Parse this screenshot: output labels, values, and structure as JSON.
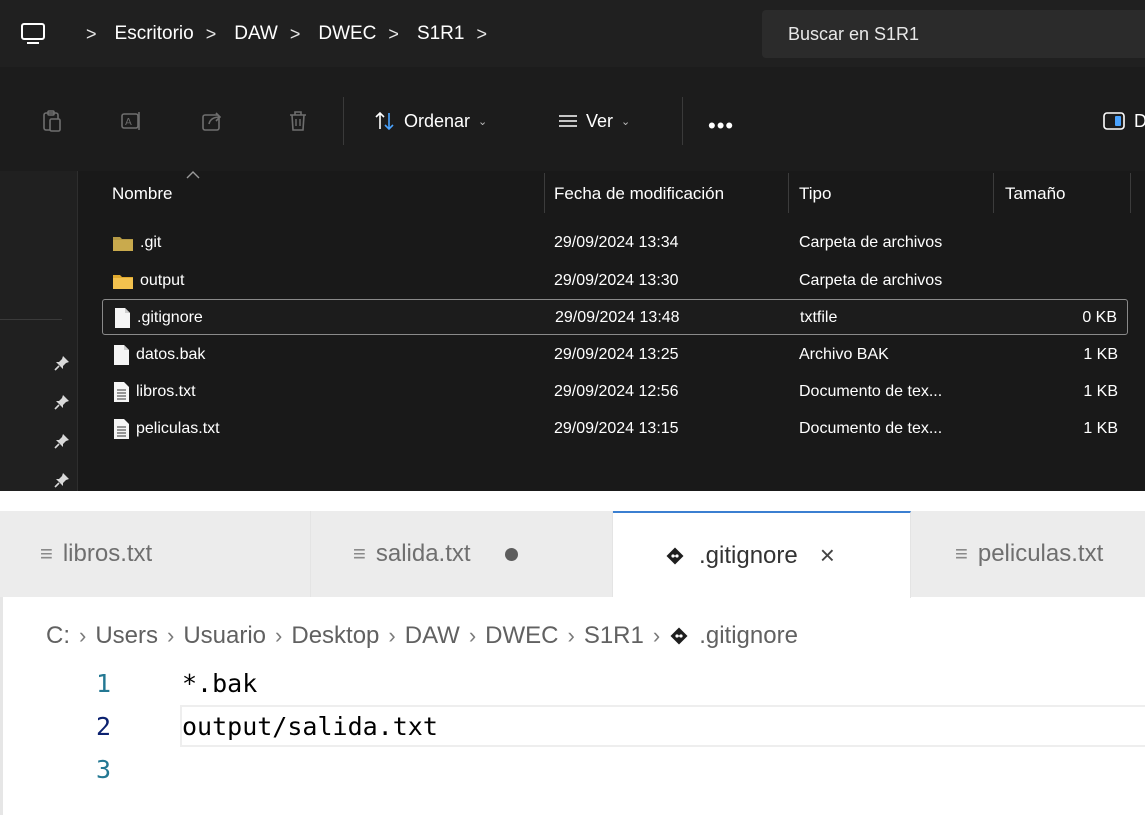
{
  "explorer": {
    "breadcrumbs": [
      "Escritorio",
      "DAW",
      "DWEC",
      "S1R1"
    ],
    "search_placeholder": "Buscar en S1R1",
    "toolbar": {
      "sort_label": "Ordenar",
      "view_label": "Ver",
      "more_label": "•••",
      "details_label": "Detalles"
    },
    "columns": {
      "name": "Nombre",
      "date": "Fecha de modificación",
      "type": "Tipo",
      "size": "Tamaño"
    },
    "files": [
      {
        "name": ".git",
        "date": "29/09/2024 13:34",
        "type": "Carpeta de archivos",
        "size": "",
        "icon": "folder-dark-icon"
      },
      {
        "name": "output",
        "date": "29/09/2024 13:30",
        "type": "Carpeta de archivos",
        "size": "",
        "icon": "folder-icon"
      },
      {
        "name": ".gitignore",
        "date": "29/09/2024 13:48",
        "type": "txtfile",
        "size": "0 KB",
        "icon": "file-icon",
        "selected": true
      },
      {
        "name": "datos.bak",
        "date": "29/09/2024 13:25",
        "type": "Archivo BAK",
        "size": "1 KB",
        "icon": "file-icon"
      },
      {
        "name": "libros.txt",
        "date": "29/09/2024 12:56",
        "type": "Documento de tex...",
        "size": "1 KB",
        "icon": "text-file-icon"
      },
      {
        "name": "peliculas.txt",
        "date": "29/09/2024 13:15",
        "type": "Documento de tex...",
        "size": "1 KB",
        "icon": "text-file-icon"
      }
    ]
  },
  "editor": {
    "tabs": [
      {
        "label": "libros.txt",
        "icon": "lines-icon"
      },
      {
        "label": "salida.txt",
        "icon": "lines-icon",
        "dirty": true
      },
      {
        "label": ".gitignore",
        "icon": "git-diamond-icon",
        "active": true,
        "close": "×"
      },
      {
        "label": "peliculas.txt",
        "icon": "lines-icon"
      }
    ],
    "breadcrumb": [
      "C:",
      "Users",
      "Usuario",
      "Desktop",
      "DAW",
      "DWEC",
      "S1R1",
      ".gitignore"
    ],
    "breadcrumb_sep": "›",
    "lines": [
      {
        "number": "1",
        "text": "*.bak"
      },
      {
        "number": "2",
        "text": "output/salida.txt",
        "current": true
      },
      {
        "number": "3",
        "text": ""
      }
    ]
  },
  "colors": {
    "explorer_bg": "#191919",
    "folder": "#f2c14e",
    "git_diamond": "#1e1e1e",
    "active_tab_accent": "#3b7fd1",
    "line_number": "#237893"
  }
}
